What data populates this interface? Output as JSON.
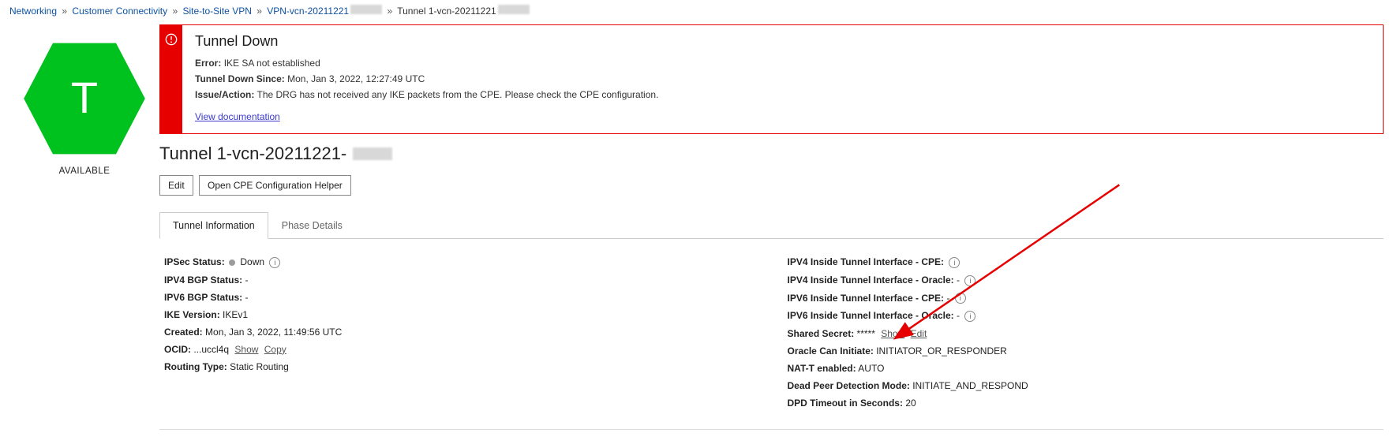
{
  "breadcrumb": {
    "items": [
      {
        "label": "Networking",
        "link": true
      },
      {
        "label": "Customer Connectivity",
        "link": true
      },
      {
        "label": "Site-to-Site VPN",
        "link": true
      },
      {
        "label": "VPN-vcn-20211221",
        "link": true,
        "redacted_suffix": true
      },
      {
        "label": "Tunnel 1-vcn-20211221",
        "link": false,
        "redacted_suffix": true
      }
    ]
  },
  "resource": {
    "icon_letter": "T",
    "status": "AVAILABLE",
    "color": "#00c21e"
  },
  "alert": {
    "title": "Tunnel Down",
    "error_label": "Error:",
    "error_value": "IKE SA not established",
    "since_label": "Tunnel Down Since:",
    "since_value": "Mon, Jan 3, 2022, 12:27:49 UTC",
    "issue_label": "Issue/Action:",
    "issue_value": "The DRG has not received any IKE packets from the CPE. Please check the CPE configuration.",
    "doc_link": "View documentation"
  },
  "header": {
    "title_prefix": "Tunnel 1-vcn-20211221-"
  },
  "actions": {
    "edit": "Edit",
    "open_helper": "Open CPE Configuration Helper"
  },
  "tabs": {
    "tunnel_info": "Tunnel Information",
    "phase_details": "Phase Details"
  },
  "left_details": {
    "ipsec_status_label": "IPSec Status:",
    "ipsec_status_value": "Down",
    "ipv4_bgp_label": "IPV4 BGP Status:",
    "ipv4_bgp_value": "-",
    "ipv6_bgp_label": "IPV6 BGP Status:",
    "ipv6_bgp_value": "-",
    "ike_version_label": "IKE Version:",
    "ike_version_value": "IKEv1",
    "created_label": "Created:",
    "created_value": "Mon, Jan 3, 2022, 11:49:56 UTC",
    "ocid_label": "OCID:",
    "ocid_value": "...uccl4q",
    "ocid_show": "Show",
    "ocid_copy": "Copy",
    "routing_type_label": "Routing Type:",
    "routing_type_value": "Static Routing"
  },
  "right_details": {
    "ipv4_cpe_label": "IPV4 Inside Tunnel Interface - CPE:",
    "ipv4_cpe_value": "",
    "ipv4_oracle_label": "IPV4 Inside Tunnel Interface - Oracle:",
    "ipv4_oracle_value": "-",
    "ipv6_cpe_label": "IPV6 Inside Tunnel Interface - CPE:",
    "ipv6_cpe_value": "-",
    "ipv6_oracle_label": "IPV6 Inside Tunnel Interface - Oracle:",
    "ipv6_oracle_value": "-",
    "shared_secret_label": "Shared Secret:",
    "shared_secret_value": "*****",
    "shared_secret_show": "Show",
    "shared_secret_edit": "Edit",
    "oracle_initiate_label": "Oracle Can Initiate:",
    "oracle_initiate_value": "INITIATOR_OR_RESPONDER",
    "nat_t_label": "NAT-T enabled:",
    "nat_t_value": "AUTO",
    "dpd_mode_label": "Dead Peer Detection Mode:",
    "dpd_mode_value": "INITIATE_AND_RESPOND",
    "dpd_timeout_label": "DPD Timeout in Seconds:",
    "dpd_timeout_value": "20"
  }
}
